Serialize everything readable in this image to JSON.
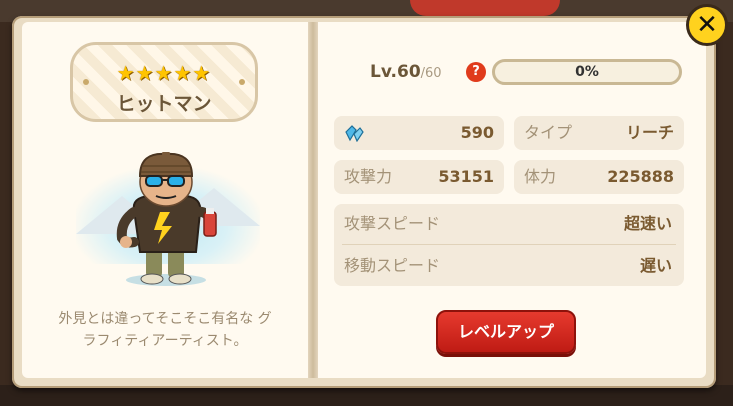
{
  "character": {
    "stars": "★★★★★",
    "name": "ヒットマン",
    "description_line1": "外見とは違ってそこそこ有名な グ",
    "description_line2": "ラフィティアーティスト。"
  },
  "level": {
    "label": "Lv.60",
    "max": "/60",
    "help": "?",
    "xp_text": "0%",
    "xp_fraction": 0
  },
  "stats": {
    "cost_value": "590",
    "type_label": "タイプ",
    "type_value": "リーチ",
    "attack_label": "攻撃力",
    "attack_value": "53151",
    "hp_label": "体力",
    "hp_value": "225888",
    "attack_speed_label": "攻撃スピード",
    "attack_speed_value": "超速い",
    "move_speed_label": "移動スピード",
    "move_speed_value": "遅い"
  },
  "buttons": {
    "level_up": "レベルアップ",
    "close": "✕"
  },
  "colors": {
    "accent_red": "#d62b20",
    "close_yellow": "#ffd21e",
    "xp_green": "#8bd04a"
  }
}
